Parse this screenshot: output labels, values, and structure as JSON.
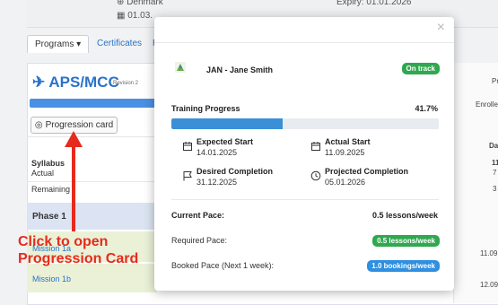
{
  "background": {
    "country": "Denmark",
    "date_fragment": "01.03.",
    "expiry": "Expiry: 01.01.2026",
    "tabs": [
      {
        "label": "Programs"
      },
      {
        "label": "Certificates"
      },
      {
        "label": "Re"
      }
    ],
    "program_title": "APS/MCC",
    "program_revision": "Revision 2",
    "progression_button": "Progression card",
    "rows": {
      "syllabus": "Syllabus",
      "actual": "Actual",
      "remaining": "Remaining",
      "phase": "Phase 1",
      "mission_1a": "Mission 1a",
      "mission_1b": "Mission 1b"
    },
    "right_column": {
      "header_p": "Pr",
      "header_enrolled": "Enrolle",
      "header_d": "Da",
      "val1": "11",
      "val2": "7",
      "val3": "3",
      "date1": "11.09",
      "date2": "12.09"
    }
  },
  "callout": {
    "line1": "Click to open",
    "line2": "Progression Card",
    "color": "#e62b1d"
  },
  "modal": {
    "close_glyph": "×",
    "student_name": "JAN - Jane Smith",
    "status_badge": "On track",
    "training_progress_label": "Training Progress",
    "training_progress_value": "41.7%",
    "training_progress_fraction": 0.417,
    "dates": {
      "expected_start_label": "Expected Start",
      "expected_start_value": "14.01.2025",
      "actual_start_label": "Actual Start",
      "actual_start_value": "11.09.2025",
      "desired_completion_label": "Desired Completion",
      "desired_completion_value": "31.12.2025",
      "projected_completion_label": "Projected Completion",
      "projected_completion_value": "05.01.2026"
    },
    "pace": {
      "current_label": "Current Pace:",
      "current_value": "0.5 lessons/week",
      "required_label": "Required Pace:",
      "required_value": "0.5 lessons/week",
      "booked_label": "Booked Pace (Next 1 week):",
      "booked_value": "1.0 bookings/week"
    },
    "colors": {
      "on_track": "#2fa84f",
      "progress_fill": "#3b8fd6",
      "booked_badge": "#2f8fe0"
    }
  }
}
